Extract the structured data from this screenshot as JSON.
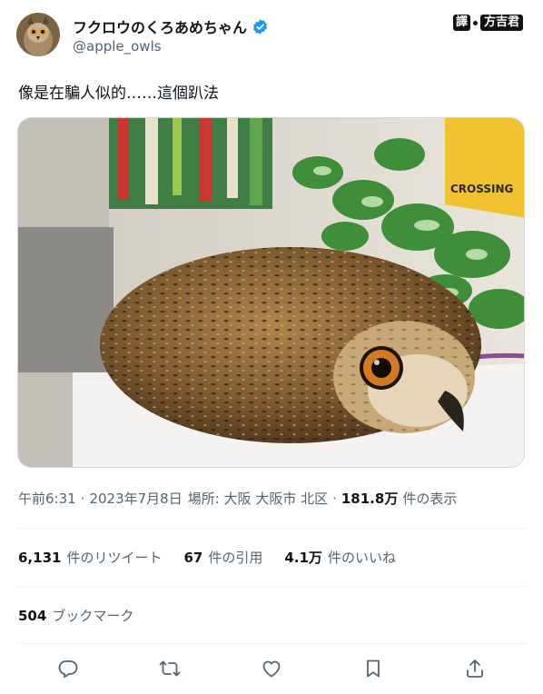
{
  "author": {
    "display_name": "フクロウのくろあめちゃん",
    "handle": "@apple_owls",
    "verified": true
  },
  "translator_watermark": {
    "badge": "譯",
    "name": "方吉君"
  },
  "tweet": {
    "text": "像是在騙人似的……這個趴法",
    "media_sign_text": "CROSSING"
  },
  "meta": {
    "time": "午前6:31",
    "date": "2023年7月8日",
    "place_label": "場所: 大阪 大阪市 北区",
    "views_count": "181.8万",
    "views_label": "件の表示",
    "separator": "·"
  },
  "stats": {
    "retweets": {
      "count": "6,131",
      "label": "件のリツイート"
    },
    "quotes": {
      "count": "67",
      "label": "件の引用"
    },
    "likes": {
      "count": "4.1万",
      "label": "件のいいね"
    }
  },
  "bookmarks": {
    "count": "504",
    "label": "ブックマーク"
  },
  "actions": [
    {
      "name": "reply",
      "icon": "reply-icon"
    },
    {
      "name": "retweet",
      "icon": "retweet-icon"
    },
    {
      "name": "like",
      "icon": "heart-icon"
    },
    {
      "name": "bookmark",
      "icon": "bookmark-icon"
    },
    {
      "name": "share",
      "icon": "share-icon"
    }
  ],
  "colors": {
    "text_primary": "#0f1419",
    "text_secondary": "#536471",
    "verified_blue": "#1d9bf0",
    "divider": "#eff3f4"
  }
}
